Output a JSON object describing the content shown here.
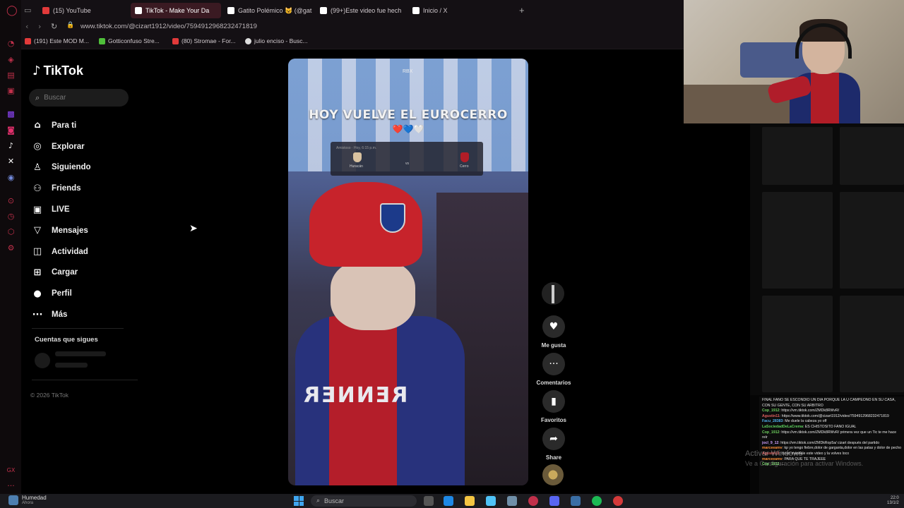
{
  "browser": {
    "tabs": [
      {
        "label": "(15) YouTube",
        "color": "#e23a3a"
      },
      {
        "label": "TikTok - Make Your Da",
        "color": "#ffffff",
        "active": true
      },
      {
        "label": "Gatito Polémico 😺 (@gat",
        "color": "#ffffff"
      },
      {
        "label": "(99+)Este video fue hech",
        "color": "#ffffff"
      },
      {
        "label": "Inicio / X",
        "color": "#ffffff"
      }
    ],
    "new_tab": "+",
    "url": "www.tiktok.com/@cizart1912/video/7594912968232471819",
    "bookmarks": [
      {
        "label": "(191) Este MOD M...",
        "color": "#e23a3a"
      },
      {
        "label": "Gotticonfuso Stre...",
        "color": "#4fbf3a"
      },
      {
        "label": "(80) Stromae - For...",
        "color": "#e23a3a"
      },
      {
        "label": "julio enciso - Busc...",
        "color": "#dddddd"
      }
    ]
  },
  "tiktok": {
    "logo": "TikTok",
    "search_placeholder": "Buscar",
    "menu": [
      {
        "icon": "home-icon",
        "glyph": "⌂",
        "label": "Para ti"
      },
      {
        "icon": "compass-icon",
        "glyph": "◎",
        "label": "Explorar"
      },
      {
        "icon": "following-icon",
        "glyph": "♙",
        "label": "Siguiendo"
      },
      {
        "icon": "friends-icon",
        "glyph": "⚇",
        "label": "Friends"
      },
      {
        "icon": "live-icon",
        "glyph": "▣",
        "label": "LIVE"
      },
      {
        "icon": "messages-icon",
        "glyph": "▽",
        "label": "Mensajes"
      },
      {
        "icon": "activity-icon",
        "glyph": "◫",
        "label": "Actividad"
      },
      {
        "icon": "upload-icon",
        "glyph": "⊞",
        "label": "Cargar"
      },
      {
        "icon": "profile-icon",
        "glyph": "●",
        "label": "Perfil"
      },
      {
        "icon": "more-icon",
        "glyph": "···",
        "label": "Más"
      }
    ],
    "following_title": "Cuentas que sigues",
    "copyright": "© 2026 TikTok"
  },
  "video": {
    "overlay_text": "HOY VUELVE EL EUROCERRO",
    "hearts": "❤️💙🤍",
    "watermark": "RBX",
    "scoreboard": {
      "top": "Amistoso · Hoy, 6:15 p.m.",
      "team_left": "Huracán",
      "vs": "vs",
      "team_right": "Cerro"
    },
    "jersey_text": "RENNER"
  },
  "actions": [
    {
      "name": "like",
      "glyph": "♥",
      "label": "Me gusta"
    },
    {
      "name": "comments",
      "glyph": "···",
      "label": "Comentarios"
    },
    {
      "name": "favorites",
      "glyph": "▮",
      "label": "Favoritos"
    },
    {
      "name": "share",
      "glyph": "➦",
      "label": "Share"
    }
  ],
  "chat": [
    {
      "user": "",
      "color": "#ffffff",
      "text": "FINAL FANO SE ESCONDIO UN DIA PORQUE LA U CAMPEONO EN SU CASA, CON SU GENTE, CON SU ARBITRO"
    },
    {
      "user": "Cop_1912",
      "color": "#6fd35f",
      "text": ": https://vm.tiktok.com/ZMDk8RWvR/"
    },
    {
      "user": "Agustin11",
      "color": "#e06060",
      "text": ": https://www.tiktok.com/@cizart1912/video/7594912968232471819"
    },
    {
      "user": "Facu_28383",
      "color": "#4faeea",
      "text": ": Me duele la cabeza yo off"
    },
    {
      "user": "LaSociedadDeLaCrema",
      "color": "#5fd35f",
      "text": ": ES CHISTOSITO FANO IGUAL"
    },
    {
      "user": "Cop_1912",
      "color": "#6fd35f",
      "text": ": https://vm.tiktok.com/ZMDk8RWvR/ primera vez que un Tic te me hace reír"
    },
    {
      "user": "jocl_9_12",
      "color": "#cfa0ff",
      "text": ": https://vm.tiktok.com/ZMDkRop5a/ cizart después del partido"
    },
    {
      "user": "marceeamv",
      "color": "#ff8f3a",
      "text": ": kp yo tengo fiebre,dolor de garganta,dolor en las patas y dolor de pecho"
    },
    {
      "user": "Agustin11",
      "color": "#e06060",
      "text": ": cizart mandale este video y la volves loco"
    },
    {
      "user": "marceeamv",
      "color": "#ff8f3a",
      "text": ": PARA QUE TE TRAJEEE"
    },
    {
      "user": "Cop_1912",
      "color": "#6fd35f",
      "text": ": ..."
    }
  ],
  "windows_activation": {
    "line1": "Activar Windows",
    "line2": "Ve a Configuración para activar Windows."
  },
  "taskbar": {
    "weather_title": "Humedad",
    "weather_sub": "Ahora",
    "search_label": "Buscar",
    "time": "22:0",
    "date": "13/1/2"
  }
}
